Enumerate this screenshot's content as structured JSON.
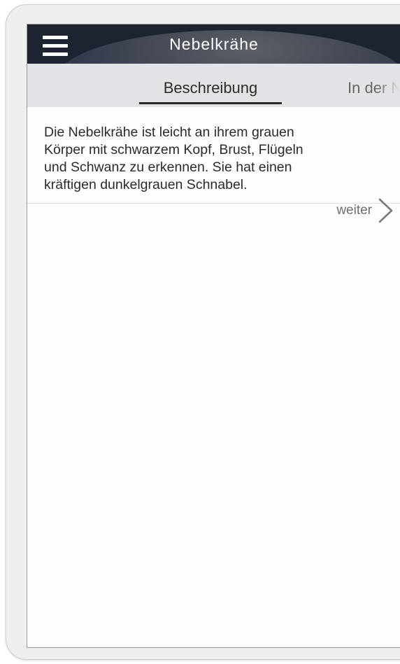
{
  "app": {
    "title": "Nebelkrähe",
    "menu_icon": "hamburger-menu-icon"
  },
  "tabs": [
    {
      "label": "Beschreibung",
      "active": true
    },
    {
      "label": "In der Natur",
      "active": false
    }
  ],
  "description": {
    "line1": "Die Nebelkrähe ist leicht an ihrem grauen",
    "line2": "Körper mit schwarzem Kopf, Brust, Flügeln",
    "line3": "und Schwanz zu erkennen. Sie hat einen",
    "line4": "kräftigen dunkelgrauen Schnabel."
  },
  "navigation": {
    "next_label": "weiter",
    "next_icon": "chevron-right-icon"
  },
  "colors": {
    "appbar": "#1d2331",
    "tabbar": "#e1e3e6",
    "text": "#2b2b2b"
  }
}
